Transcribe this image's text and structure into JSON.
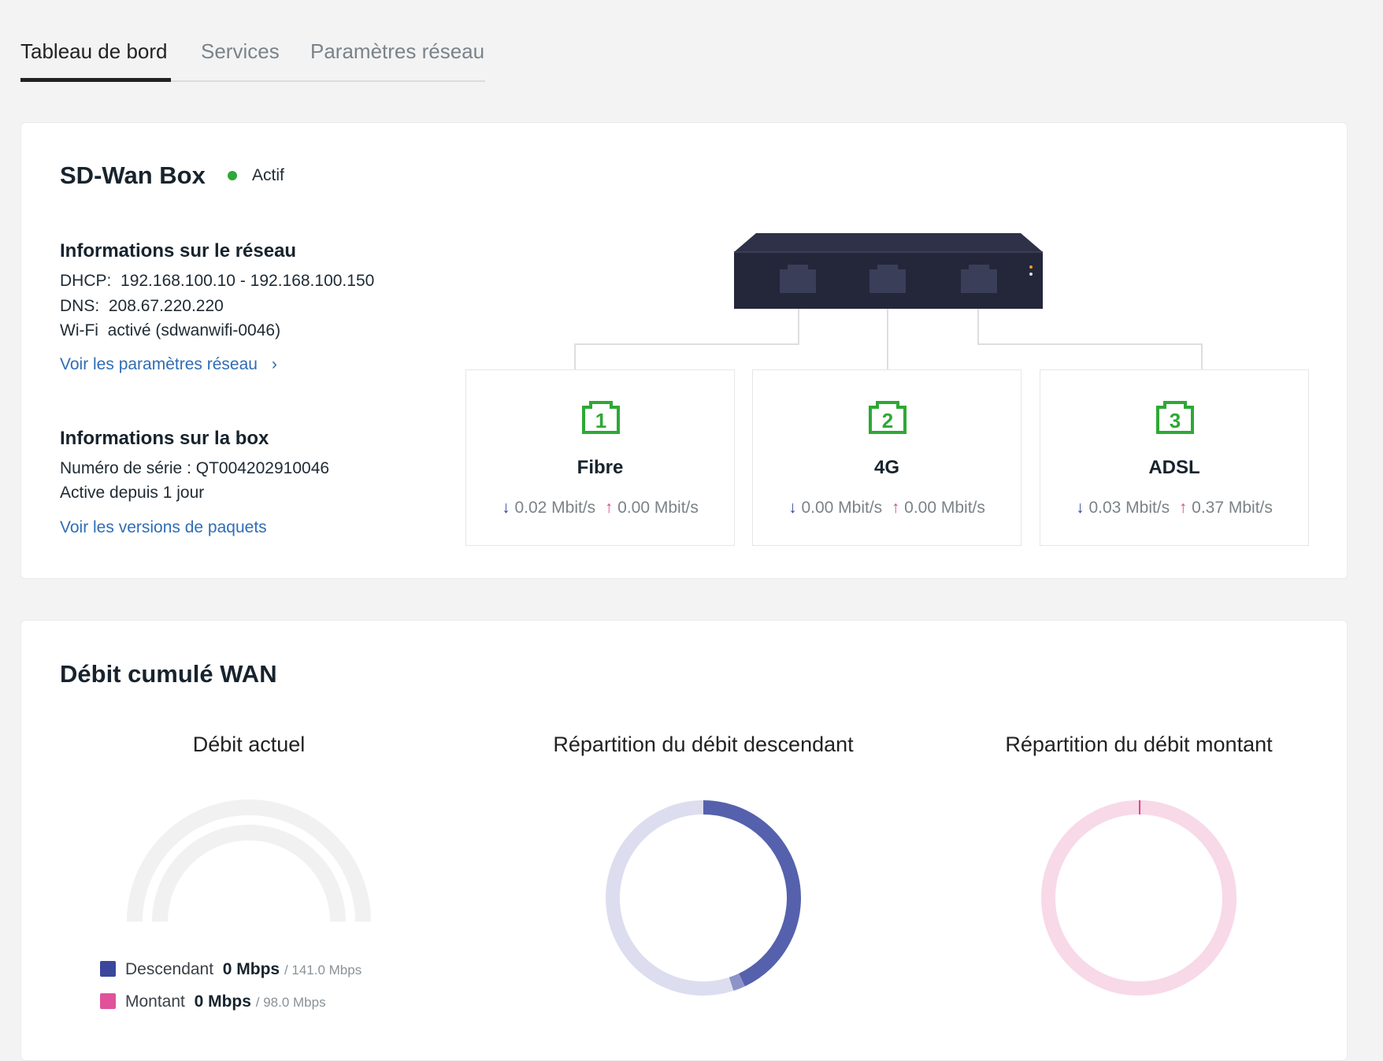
{
  "tabs": [
    {
      "label": "Tableau de bord",
      "active": true
    },
    {
      "label": "Services"
    },
    {
      "label": "Paramètres réseau"
    }
  ],
  "box": {
    "title": "SD-Wan Box",
    "status": "Actif",
    "status_color": "#2ea836",
    "network": {
      "heading": "Informations sur le réseau",
      "dhcp_label": "DHCP:",
      "dhcp": "192.168.100.10 - 192.168.100.150",
      "dns_label": "DNS:",
      "dns": "208.67.220.220",
      "wifi_label": "Wi-Fi",
      "wifi": "activé (sdwanwifi-0046)",
      "link": "Voir les paramètres réseau"
    },
    "info": {
      "heading": "Informations sur la box",
      "serial": "Numéro de série : QT004202910046",
      "uptime": "Active depuis 1 jour",
      "link": "Voir les versions de paquets"
    },
    "ports": [
      {
        "number": "1",
        "name": "Fibre",
        "down": "0.02 Mbit/s",
        "up": "0.00 Mbit/s"
      },
      {
        "number": "2",
        "name": "4G",
        "down": "0.00 Mbit/s",
        "up": "0.00 Mbit/s"
      },
      {
        "number": "3",
        "name": "ADSL",
        "down": "0.03 Mbit/s",
        "up": "0.37 Mbit/s"
      }
    ]
  },
  "wan": {
    "title": "Débit cumulé WAN",
    "current": {
      "title": "Débit actuel",
      "legend": [
        {
          "label": "Descendant",
          "value": "0 Mbps",
          "max": "/ 141.0 Mbps",
          "color": "#3a479b"
        },
        {
          "label": "Montant",
          "value": "0 Mbps",
          "max": "/ 98.0 Mbps",
          "color": "#e0529a"
        }
      ]
    },
    "down_title": "Répartition du débit descendant",
    "up_title": "Répartition du débit montant"
  },
  "chart_data": [
    {
      "type": "gauge",
      "title": "Débit actuel",
      "series": [
        {
          "name": "Descendant",
          "value": 0,
          "max": 141.0
        },
        {
          "name": "Montant",
          "value": 0,
          "max": 98.0
        }
      ]
    },
    {
      "type": "pie",
      "title": "Répartition du débit descendant",
      "values": [
        43,
        2,
        55
      ],
      "colors": [
        "#5561ad",
        "#8b93c9",
        "#dcdeef"
      ]
    },
    {
      "type": "pie",
      "title": "Répartition du débit montant",
      "values": [
        0.3,
        99.7
      ],
      "colors": [
        "#e0458f",
        "#f8d9e7"
      ]
    }
  ]
}
